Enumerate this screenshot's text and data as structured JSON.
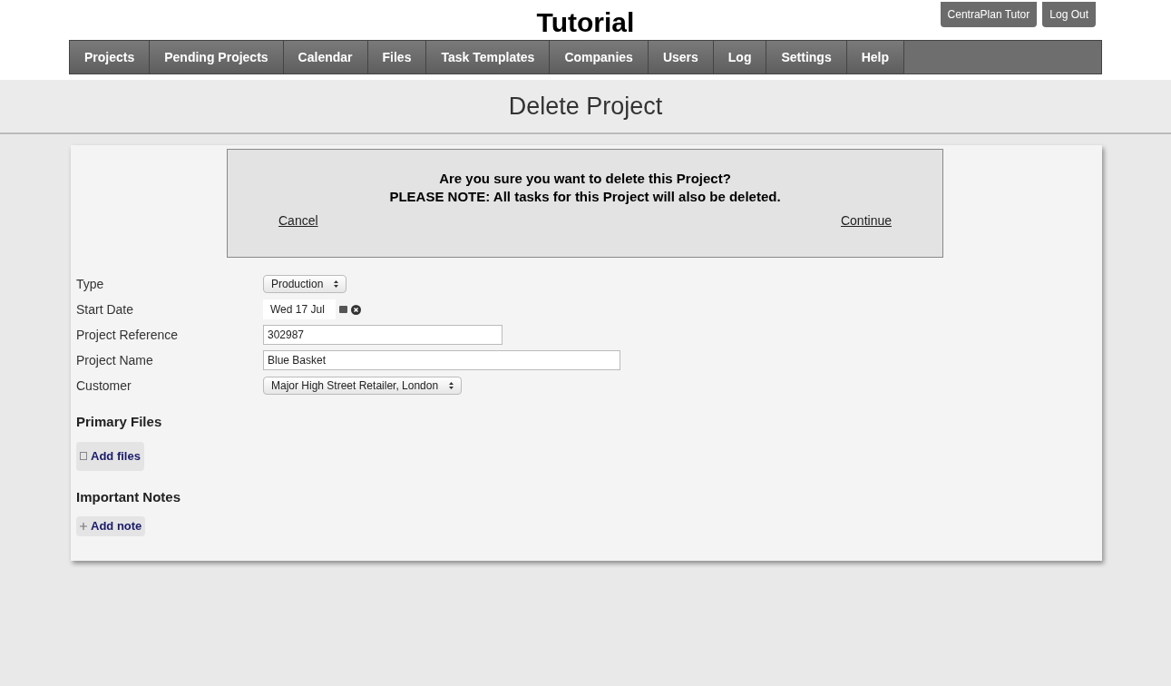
{
  "header": {
    "title": "Tutorial",
    "user_buttons": [
      "CentraPlan Tutor",
      "Log Out"
    ]
  },
  "nav": [
    {
      "label": "Projects"
    },
    {
      "label": "Pending Projects"
    },
    {
      "label": "Calendar"
    },
    {
      "label": "Files"
    },
    {
      "label": "Task Templates"
    },
    {
      "label": "Companies"
    },
    {
      "label": "Users"
    },
    {
      "label": "Log"
    },
    {
      "label": "Settings"
    },
    {
      "label": "Help"
    }
  ],
  "page_title": "Delete Project",
  "dialog": {
    "question": "Are you sure you want to delete this Project?",
    "note": "PLEASE NOTE: All tasks for this Project will also be deleted.",
    "cancel": "Cancel",
    "continue": "Continue"
  },
  "fields": [
    {
      "label": "Type",
      "kind": "select",
      "value": "Production"
    },
    {
      "label": "Start Date",
      "kind": "date",
      "value": "Wed 17 Jul"
    },
    {
      "label": "Project Reference",
      "kind": "text",
      "value": "302987"
    },
    {
      "label": "Project Name",
      "kind": "wide",
      "value": "Blue Basket"
    },
    {
      "label": "Customer",
      "kind": "select",
      "value": "Major High Street Retailer, London"
    }
  ],
  "sections": [
    {
      "heading": "Primary Files",
      "button": "Add files",
      "kind": "file"
    },
    {
      "heading": "Important Notes",
      "button": "Add note",
      "kind": "note"
    }
  ]
}
